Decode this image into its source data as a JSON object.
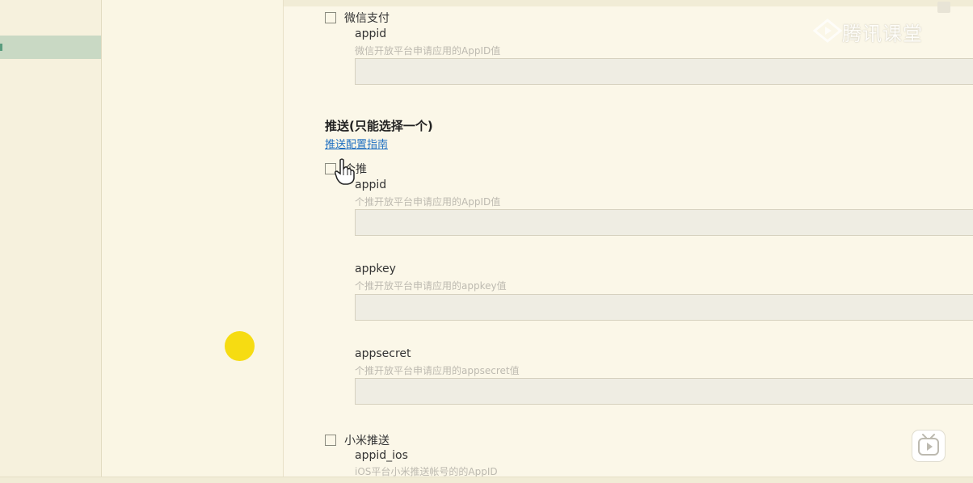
{
  "brand": {
    "text": "腾讯课堂",
    "icon": "play-diamond-icon"
  },
  "payment": {
    "wechat": {
      "label": "微信支付",
      "checked": false,
      "fields": [
        {
          "label": "appid",
          "hint": "微信开放平台申请应用的AppID值",
          "value": ""
        }
      ]
    }
  },
  "push": {
    "title": "推送(只能选择一个)",
    "guide_link": "推送配置指南",
    "getui": {
      "label": "个推",
      "checked": false,
      "fields": [
        {
          "label": "appid",
          "hint": "个推开放平台申请应用的AppID值",
          "value": ""
        },
        {
          "label": "appkey",
          "hint": "个推开放平台申请应用的appkey值",
          "value": ""
        },
        {
          "label": "appsecret",
          "hint": "个推开放平台申请应用的appsecret值",
          "value": ""
        }
      ]
    },
    "xiaomi": {
      "label": "小米推送",
      "checked": false,
      "fields": [
        {
          "label": "appid_ios",
          "hint": "iOS平台小米推送帐号的的AppID",
          "value": ""
        }
      ]
    }
  },
  "colors": {
    "background": "#fbf7e8",
    "link": "#1e6fc1",
    "highlight_dot": "#f6dc12",
    "nav_active": "#c9d9c4"
  }
}
